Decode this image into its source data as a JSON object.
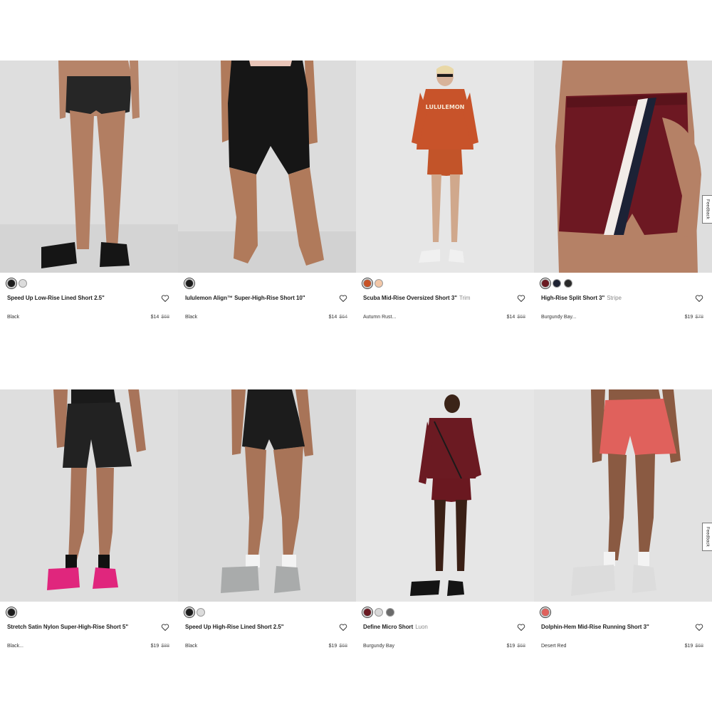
{
  "feedback_label": "Feedback",
  "products": [
    {
      "name": "Speed Up Low-Rise Lined Short 2.5\"",
      "suffix": "",
      "color": "Black",
      "price": "$14",
      "original_price": "$68",
      "swatches": [
        "#1c1c1c",
        "#dcdcdc"
      ]
    },
    {
      "name": "lululemon Align™ Super-High-Rise Short 10\"",
      "suffix": "",
      "color": "Black",
      "price": "$14",
      "original_price": "$64",
      "swatches": [
        "#1c1c1c"
      ]
    },
    {
      "name": "Scuba Mid-Rise Oversized Short 3\"",
      "suffix": "Trim",
      "color": "Autumn Rust...",
      "price": "$14",
      "original_price": "$68",
      "swatches": [
        "#c85327",
        "#f2c7a8"
      ]
    },
    {
      "name": "High-Rise Split Short 3\"",
      "suffix": "Stripe",
      "color": "Burgundy Bay...",
      "price": "$19",
      "original_price": "$78",
      "swatches": [
        "#6b1a22",
        "#1e2233",
        "#2a2a2a"
      ]
    },
    {
      "name": "Stretch Satin Nylon Super-High-Rise Short 5\"",
      "suffix": "",
      "color": "Black...",
      "price": "$19",
      "original_price": "$88",
      "swatches": [
        "#1c1c1c"
      ]
    },
    {
      "name": "Speed Up High-Rise Lined Short 2.5\"",
      "suffix": "",
      "color": "Black",
      "price": "$19",
      "original_price": "$68",
      "swatches": [
        "#1c1c1c",
        "#dcdcdc"
      ]
    },
    {
      "name": "Define Micro Short",
      "suffix": "Luon",
      "color": "Burgundy Bay",
      "price": "$19",
      "original_price": "$68",
      "swatches": [
        "#6b1a22",
        "#d9d9d9",
        "#6a6a6a"
      ]
    },
    {
      "name": "Dolphin-Hem Mid-Rise Running Short 3\"",
      "suffix": "",
      "color": "Desert Red",
      "price": "$19",
      "original_price": "$68",
      "swatches": [
        "#e0615c"
      ]
    }
  ]
}
